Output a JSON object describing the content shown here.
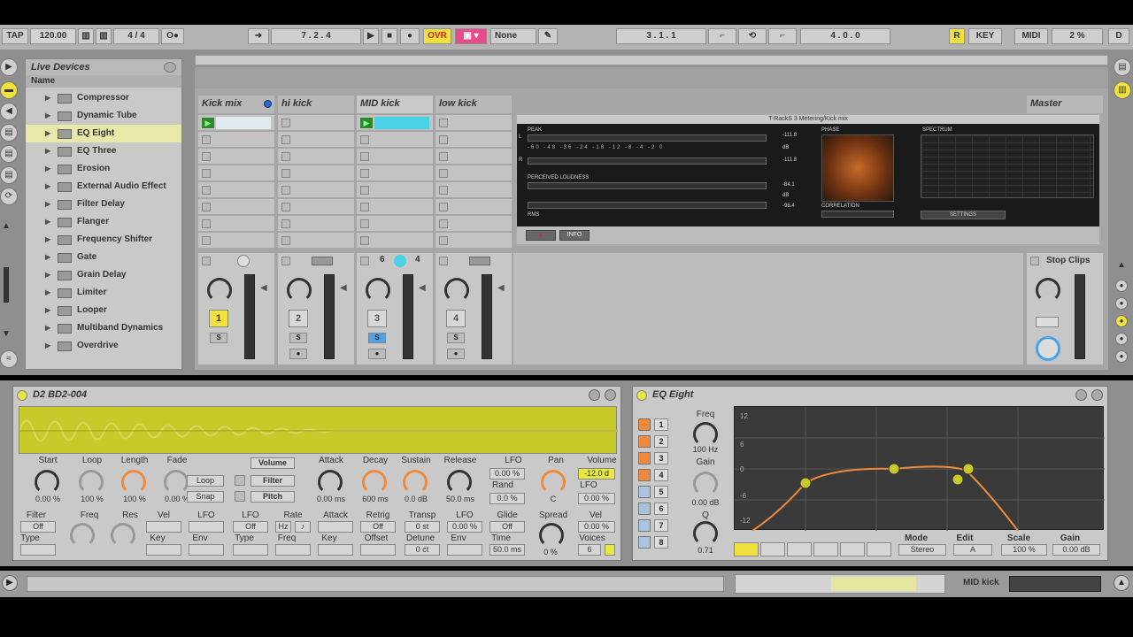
{
  "transport": {
    "tap": "TAP",
    "tempo": "120.00",
    "sig": "4 / 4",
    "metro": "O●",
    "position": "7 . 2 . 4",
    "ovr": "OVR",
    "none": "None",
    "loop_start": "3 . 1 . 1",
    "loop_len": "4 . 0 . 0",
    "key": "KEY",
    "midi": "MIDI",
    "cpu": "2 %",
    "d": "D"
  },
  "browser": {
    "title": "Live Devices",
    "col_name": "Name",
    "items": [
      "Compressor",
      "Dynamic Tube",
      "EQ Eight",
      "EQ Three",
      "Erosion",
      "External Audio Effect",
      "Filter Delay",
      "Flanger",
      "Frequency Shifter",
      "Gate",
      "Grain Delay",
      "Limiter",
      "Looper",
      "Multiband Dynamics",
      "Overdrive"
    ]
  },
  "tracks": [
    {
      "name": "Kick mix",
      "num": "1",
      "s": "S"
    },
    {
      "name": "hi kick",
      "num": "2",
      "s": "S"
    },
    {
      "name": "MID kick",
      "num": "3",
      "s": "S"
    },
    {
      "name": "low kick",
      "num": "4",
      "s": "S"
    }
  ],
  "master": {
    "name": "Master",
    "stop": "Stop Clips"
  },
  "mid_values": {
    "a": "6",
    "b": "4"
  },
  "plugin": {
    "title": "T-RackS 3 Metering/Kick mix",
    "peak": "PEAK",
    "rms": "RMS",
    "perceived": "PERCEIVED LOUDNESS",
    "phase": "PHASE",
    "correlation": "CORRELATION",
    "spectrum": "SPECTRUM",
    "settings": "SETTINGS",
    "info": "INFO",
    "peak_l": "-111.8",
    "peak_r": "-111.8",
    "db1": "dB",
    "pl_val": "-84.1",
    "db2": "dB",
    "rms_val": "-96.4",
    "l": "L",
    "r": "R"
  },
  "sampler": {
    "title": "D2 BD2-004",
    "labels": [
      "Start",
      "Loop",
      "Length",
      "Fade",
      "Attack",
      "Decay",
      "Sustain",
      "Release",
      "LFO",
      "Pan",
      "Volume"
    ],
    "values": [
      "0.00 %",
      "100 %",
      "100 %",
      "0.00 %",
      "0.00 ms",
      "600 ms",
      "0.0 dB",
      "50.0 ms",
      "-12.0 d"
    ],
    "tabs": [
      "Volume",
      "Filter",
      "Pitch"
    ],
    "loop_btn": "Loop",
    "snap_btn": "Snap",
    "lfo_val": "0.00 %",
    "rand": "Rand",
    "rand_val": "0.0 %",
    "pan_val": "C",
    "vol_lfo": "LFO",
    "vol_lfo_val": "0.00 %",
    "row2_labels": [
      "Filter",
      "Freq",
      "Res",
      "Vel",
      "LFO",
      "LFO",
      "Rate",
      "Attack",
      "Retrig",
      "Transp",
      "LFO",
      "Glide",
      "Spread",
      "Vel"
    ],
    "off1": "Off",
    "type": "Type",
    "key": "Key",
    "env": "Env",
    "off2": "Off",
    "hz": "Hz",
    "type2": "Type",
    "freq2": "Freq",
    "key2": "Key",
    "off3": "Off",
    "offset": "Offset",
    "transp_val": "0 st",
    "detune": "Detune",
    "detune_val": "0 ct",
    "lfo_val2": "0.00 %",
    "env2": "Env",
    "glide_off": "Off",
    "time": "Time",
    "time_val": "50.0 ms",
    "spread_val": "0 %",
    "vel_val": "0.00 %",
    "voices": "Voices",
    "voices_val": "6"
  },
  "eq": {
    "title": "EQ Eight",
    "bands": [
      "1",
      "2",
      "3",
      "4",
      "5",
      "6",
      "7",
      "8"
    ],
    "freq": "Freq",
    "freq_val": "100 Hz",
    "gain": "Gain",
    "gain_val": "0.00 dB",
    "q": "Q",
    "q_val": "0.71",
    "mode": "Mode",
    "mode_val": "Stereo",
    "edit": "Edit",
    "edit_val": "A",
    "scale": "Scale",
    "scale_val": "100 %",
    "gain2": "Gain",
    "gain2_val": "0.00 dB",
    "ylabels": [
      "12",
      "6",
      "0",
      "-6",
      "-12"
    ]
  },
  "status": {
    "track": "MID kick"
  },
  "colors": {
    "accent_yellow": "#e8e840",
    "accent_orange": "#f08a3a",
    "cyan": "#4ad2e6",
    "ovr": "#f2e13c",
    "pink": "#e84a8a"
  }
}
